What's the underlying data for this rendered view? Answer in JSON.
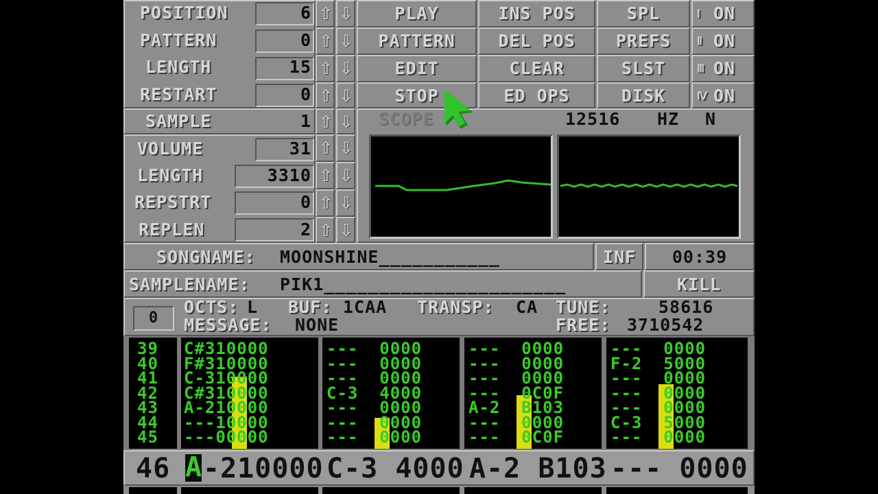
{
  "song": {
    "position": {
      "label": "POSITION",
      "value": "6"
    },
    "pattern": {
      "label": "PATTERN",
      "value": "0"
    },
    "length": {
      "label": "LENGTH",
      "value": "15"
    },
    "restart": {
      "label": "RESTART",
      "value": "0"
    }
  },
  "sample": {
    "sample": {
      "label": "SAMPLE",
      "value": "1"
    },
    "volume": {
      "label": "VOLUME",
      "value": "31"
    },
    "length": {
      "label": "LENGTH",
      "value": "3310"
    },
    "repstrt": {
      "label": "REPSTRT",
      "value": "0"
    },
    "replen": {
      "label": "REPLEN",
      "value": "2"
    }
  },
  "arrows": {
    "up": "⇧",
    "down": "⇩"
  },
  "buttons": {
    "play": "PLAY",
    "pattern": "PATTERN",
    "edit": "EDIT",
    "stop": "STOP",
    "ins_pos": "INS POS",
    "del_pos": "DEL POS",
    "clear": "CLEAR",
    "ed_ops": "ED OPS",
    "spl": "SPL",
    "prefs": "PREFS",
    "slst": "SLST",
    "disk": "DISK",
    "inf": "INF",
    "kill": "KILL"
  },
  "channels": [
    {
      "num": "Ⅰ",
      "state": "ON"
    },
    {
      "num": "Ⅱ",
      "state": "ON"
    },
    {
      "num": "Ⅲ",
      "state": "ON"
    },
    {
      "num": "Ⅳ",
      "state": "ON"
    }
  ],
  "scope": {
    "label": "SCOPE",
    "freq": "12516",
    "hz": "HZ",
    "mode": "N"
  },
  "songname": {
    "label": "SONGNAME:",
    "value": "MOONSHINE___________"
  },
  "samplename": {
    "label": "SAMPLENAME:",
    "value": "PIK1______________________"
  },
  "time": "00:39",
  "info": {
    "octave_box": "0",
    "octs_label": "OCTS:",
    "octs_value": "L",
    "buf_label": "BUF:",
    "buf_value": "1CAA",
    "transp_label": "TRANSP:",
    "transp_value": "CA",
    "tune_label": "TUNE:",
    "tune_value": "58616",
    "message_label": "MESSAGE:",
    "message_value": "NONE",
    "free_label": "FREE:",
    "free_value": "3710542"
  },
  "pattern_rows": {
    "numbers": "39\n40\n41\n42\n43\n44\n45",
    "track1": "C#310000\nF#310000\nC-310000\nC#310000\nA-210000\n---10000\n---00000",
    "track2": "---  0000\n---  0000\n---  0000\nC-3  4000\n---  0000\n---  0000\n---  0000",
    "track3": "---  0000\n---  0000\n---  0000\n---  0C0F\nA-2  B103\n---  0000\n---  0C0F",
    "track4": "---  0000\nF-2  5000\n---  0000\n---  0000\n---  0000\nC-3  5000\n---  0000"
  },
  "vu_levels": [
    0.65,
    0.28,
    0.48,
    0.58
  ],
  "current_row": {
    "number": "46",
    "track1_cursor": "A",
    "track1_rest": "-210000",
    "track2": "C-3 4000",
    "track3": "A-2 B103",
    "track4": "--- 0000"
  },
  "colors": {
    "panel": "#8d8d8d",
    "pattern_text": "#3acc2a",
    "vu": "#dcdc10",
    "pointer": "#2fc52a"
  }
}
